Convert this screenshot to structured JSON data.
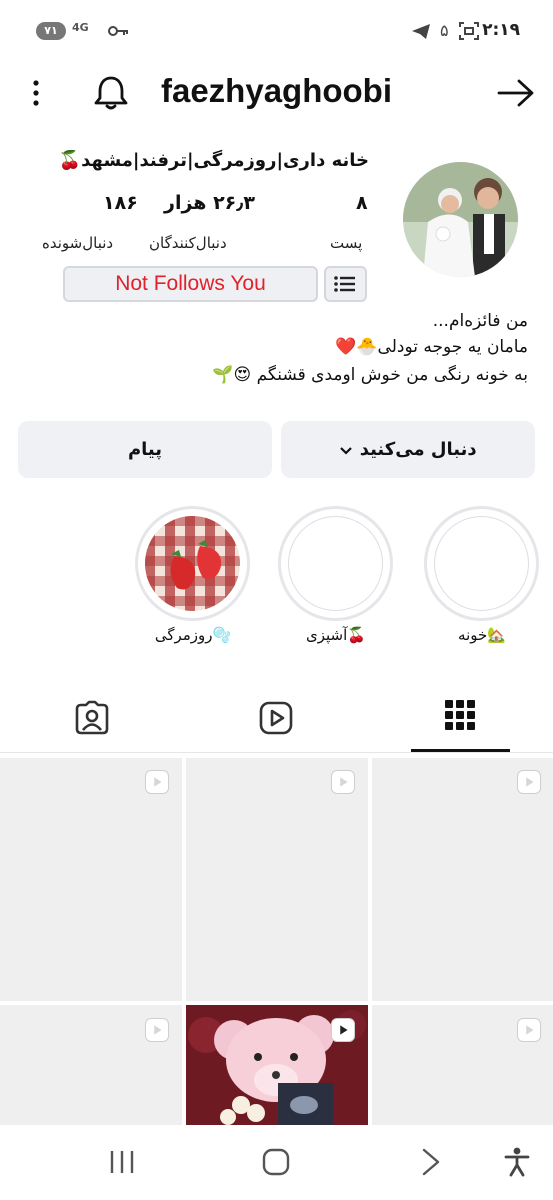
{
  "status_bar": {
    "time": "۲:۱۹",
    "battery": "۷۱",
    "network": "4G",
    "notification_count": "۵"
  },
  "header": {
    "username": "faezhyaghoobi",
    "icons": [
      "more-vertical-icon",
      "bell-icon",
      "back-arrow-icon"
    ]
  },
  "profile": {
    "title": "خانه داری|روزمرگی|ترفند|مشهد🍒",
    "stats": [
      {
        "value": "۸",
        "label": "پست"
      },
      {
        "value": "۲۶٫۳ هزار",
        "label": "دنبال‌کنندگان"
      },
      {
        "value": "۱۸۶",
        "label": "دنبال‌شونده"
      }
    ],
    "not_follows_label": "Not Follows You",
    "bio": [
      "من فائزه‌ام...",
      "مامان یه جوجه تودلی🐣❤️",
      "به خونه رنگی من خوش اومدی قشنگم 😍🌱"
    ]
  },
  "actions": {
    "follow_label": "دنبال می‌کنید",
    "message_label": "پیام"
  },
  "highlights": [
    {
      "label": "خونه🏡"
    },
    {
      "label": "آشپزی🍒"
    },
    {
      "label": "روزمرگی🫧"
    }
  ],
  "tabs": [
    "grid-icon",
    "reels-icon",
    "tagged-icon"
  ],
  "colors": {
    "accent_red": "#e0222a",
    "button_bg": "#eff1f4"
  }
}
